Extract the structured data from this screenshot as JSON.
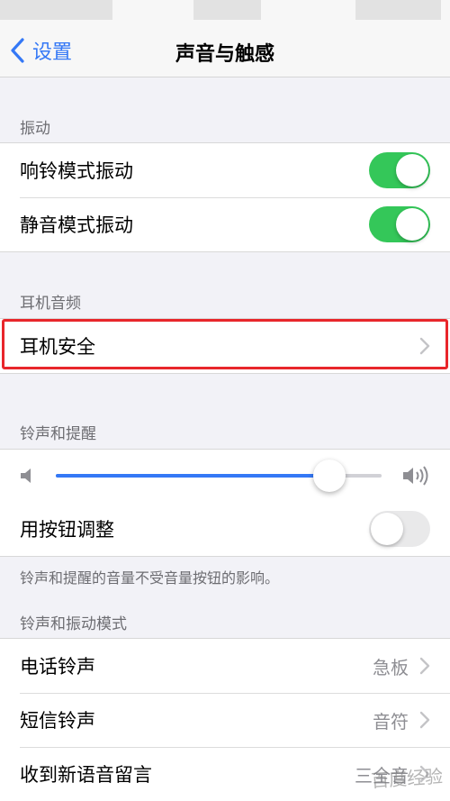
{
  "nav": {
    "back_label": "设置",
    "title": "声音与触感"
  },
  "sections": {
    "vibration": {
      "header": "振动",
      "rows": [
        {
          "label": "响铃模式振动",
          "toggle_on": true
        },
        {
          "label": "静音模式振动",
          "toggle_on": true
        }
      ]
    },
    "headphone": {
      "header": "耳机音频",
      "rows": [
        {
          "label": "耳机安全"
        }
      ]
    },
    "ringer": {
      "header": "铃声和提醒",
      "volume_fraction": 0.84,
      "change_with_buttons": {
        "label": "用按钮调整",
        "toggle_on": false
      },
      "footer": "铃声和提醒的音量不受音量按钮的影响。"
    },
    "patterns": {
      "header": "铃声和振动模式",
      "rows": [
        {
          "label": "电话铃声",
          "value": "急板"
        },
        {
          "label": "短信铃声",
          "value": "音符"
        },
        {
          "label": "收到新语音留言",
          "value": "三全音"
        }
      ]
    }
  },
  "icons": {
    "back": "chevron-left-icon",
    "disclosure": "chevron-right-icon",
    "volume_low": "speaker-low-icon",
    "volume_high": "speaker-high-icon"
  },
  "colors": {
    "accent": "#3478f6",
    "toggle_on": "#34c759",
    "highlight": "#e8262b"
  },
  "watermark": "百度经验"
}
